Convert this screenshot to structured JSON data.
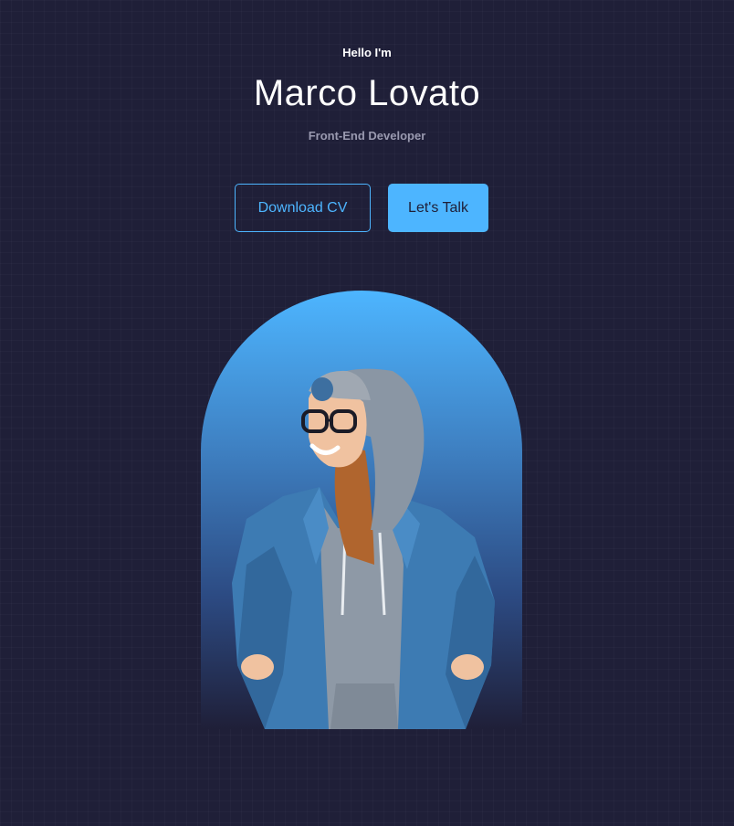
{
  "header": {
    "greeting": "Hello I'm",
    "name": "Marco Lovato",
    "role": "Front-End Developer"
  },
  "cta": {
    "download_label": "Download CV",
    "talk_label": "Let's Talk"
  },
  "colors": {
    "background": "#1f1f38",
    "accent": "#4db5ff",
    "muted_text": "#9a9ab0"
  }
}
